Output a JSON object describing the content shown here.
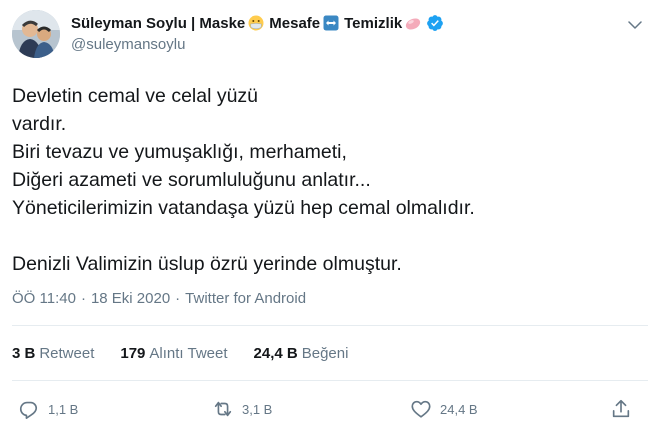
{
  "header": {
    "display_name": "Süleyman Soylu | Maske",
    "mesafe": "Mesafe",
    "temizlik": "Temizlik",
    "handle": "@suleymansoylu"
  },
  "tweet": {
    "text": "Devletin cemal ve celal yüzü\nvardır.\nBiri tevazu ve yumuşaklığı, merhameti,\nDiğeri azameti ve sorumluluğunu anlatır...\nYöneticilerimizin vatandaşa yüzü hep cemal olmalıdır.\n\nDenizli Valimizin üslup özrü yerinde olmuştur."
  },
  "meta": {
    "time": "ÖÖ 11:40",
    "sep1": "·",
    "date": "18 Eki 2020",
    "sep2": "·",
    "source": "Twitter for Android"
  },
  "stats": {
    "retweet_count": "3 B",
    "retweet_label": "Retweet",
    "quote_count": "179",
    "quote_label": "Alıntı Tweet",
    "like_count": "24,4 B",
    "like_label": "Beğeni"
  },
  "actions": {
    "reply_count": "1,1 B",
    "retweet_count": "3,1 B",
    "like_count": "24,4 B"
  },
  "colors": {
    "verified": "#1da1f2",
    "icon": "#657786",
    "divider": "#e6ecf0"
  },
  "icons": [
    "avatar",
    "mask-emoji",
    "left-right-arrow-emoji",
    "soap-emoji",
    "verified-badge-icon",
    "chevron-down-icon",
    "reply-icon",
    "retweet-icon",
    "like-icon",
    "share-icon"
  ]
}
